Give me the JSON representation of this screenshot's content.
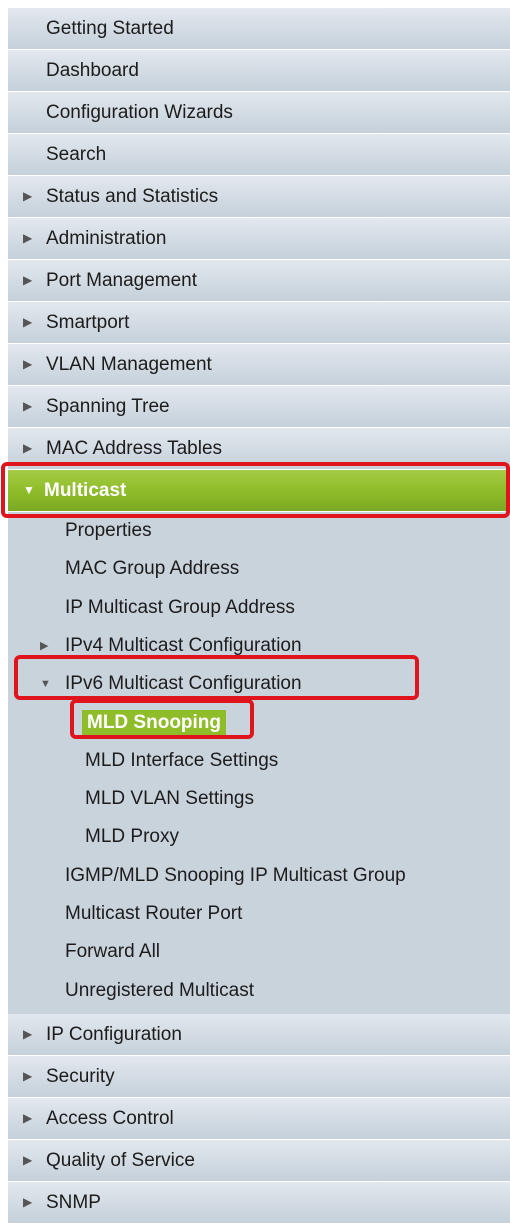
{
  "nav": {
    "top_items": [
      {
        "label": "Getting Started",
        "arrow": ""
      },
      {
        "label": "Dashboard",
        "arrow": ""
      },
      {
        "label": "Configuration Wizards",
        "arrow": ""
      },
      {
        "label": "Search",
        "arrow": ""
      },
      {
        "label": "Status and Statistics",
        "arrow": "▶"
      },
      {
        "label": "Administration",
        "arrow": "▶"
      },
      {
        "label": "Port Management",
        "arrow": "▶"
      },
      {
        "label": "Smartport",
        "arrow": "▶"
      },
      {
        "label": "VLAN Management",
        "arrow": "▶"
      },
      {
        "label": "Spanning Tree",
        "arrow": "▶"
      },
      {
        "label": "MAC Address Tables",
        "arrow": "▶"
      }
    ],
    "multicast": {
      "label": "Multicast",
      "arrow": "▼",
      "items": [
        {
          "label": "Properties",
          "arrow": ""
        },
        {
          "label": "MAC Group Address",
          "arrow": ""
        },
        {
          "label": "IP Multicast Group Address",
          "arrow": ""
        },
        {
          "label": "IPv4 Multicast Configuration",
          "arrow": "▶"
        },
        {
          "label": "IPv6 Multicast Configuration",
          "arrow": "▼"
        }
      ],
      "ipv6_children": [
        {
          "label": "MLD Snooping"
        },
        {
          "label": "MLD Interface Settings"
        },
        {
          "label": "MLD VLAN Settings"
        },
        {
          "label": "MLD Proxy"
        }
      ],
      "tail_items": [
        {
          "label": "IGMP/MLD Snooping IP Multicast Group"
        },
        {
          "label": "Multicast Router Port"
        },
        {
          "label": "Forward All"
        },
        {
          "label": "Unregistered Multicast"
        }
      ]
    },
    "bottom_items": [
      {
        "label": "IP Configuration",
        "arrow": "▶"
      },
      {
        "label": "Security",
        "arrow": "▶"
      },
      {
        "label": "Access Control",
        "arrow": "▶"
      },
      {
        "label": "Quality of Service",
        "arrow": "▶"
      },
      {
        "label": "SNMP",
        "arrow": "▶"
      }
    ]
  },
  "colors": {
    "active_green": "#8fbd2a",
    "highlight_red": "#e0141c",
    "menu_bg": "#d2dbe3"
  }
}
